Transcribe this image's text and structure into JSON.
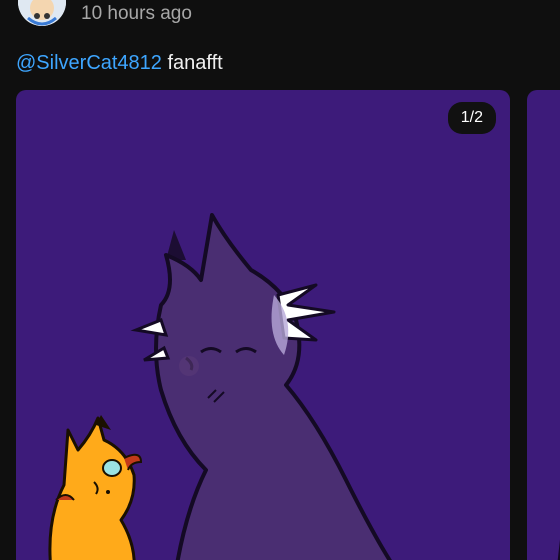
{
  "post": {
    "timestamp": "10 hours ago",
    "caption": {
      "mention": "@SilverCat4812",
      "text": "fanafft"
    },
    "carousel": {
      "counter": "1/2",
      "current_slide": 1,
      "total_slides": 2
    }
  },
  "colors": {
    "background": "#0f0f0f",
    "mention": "#3ea6ff",
    "slide_background": "#3d1b7a",
    "purple_cat": "#4a2e72",
    "orange_cat": "#ffaa1a"
  },
  "icons": {
    "avatar": "user-avatar"
  }
}
